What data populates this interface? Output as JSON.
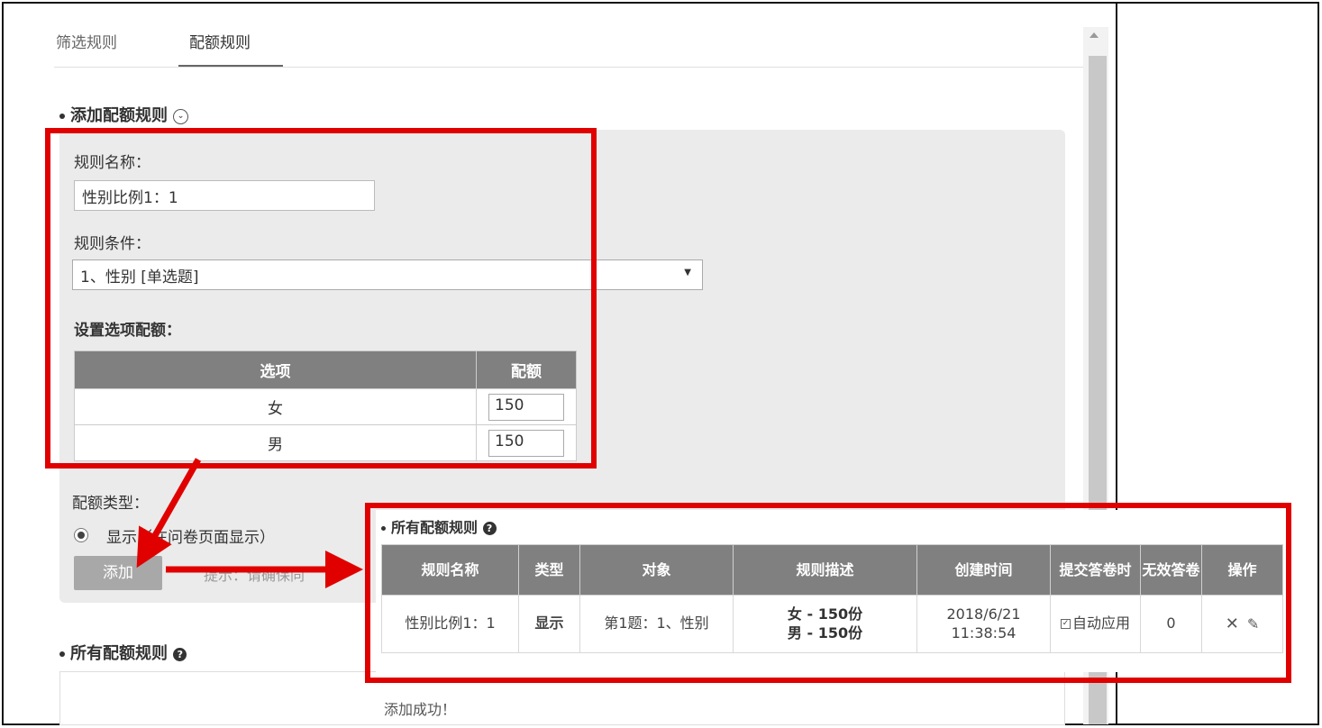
{
  "tabs": [
    {
      "label": "筛选规则",
      "active": false
    },
    {
      "label": "配额规则",
      "active": true
    }
  ],
  "add_section": {
    "title": "添加配额规则",
    "rule_name_label": "规则名称：",
    "rule_name_value": "性别比例1：1",
    "rule_condition_label": "规则条件：",
    "rule_condition_value": "1、性别 [单选题]",
    "set_quota_label": "设置选项配额：",
    "table_headers": [
      "选项",
      "配额"
    ],
    "rows": [
      {
        "option": "女",
        "quota": "150"
      },
      {
        "option": "男",
        "quota": "150"
      }
    ],
    "quota_type_label": "配额类型：",
    "radio_label": "显示（在问卷页面显示）",
    "add_button": "添加",
    "hint_text": "提示：请确保同"
  },
  "all_rules_section": {
    "title": "所有配额规则",
    "success_message": "添加成功！"
  },
  "overlay": {
    "title": "所有配额规则",
    "headers": [
      "规则名称",
      "类型",
      "对象",
      "规则描述",
      "创建时间",
      "提交答卷时",
      "无效答卷",
      "操作"
    ],
    "row": {
      "name": "性别比例1：1",
      "type": "显示",
      "target": "第1题：1、性别",
      "desc_line1": "女 - 150份",
      "desc_line2": "男 - 150份",
      "created_date": "2018/6/21",
      "created_time": "11:38:54",
      "submit_action": "自动应用",
      "invalid_count": "0"
    }
  },
  "colors": {
    "annotation_red": "#e00000",
    "header_gray": "#808080",
    "panel_gray": "#ebebeb"
  },
  "icons": [
    "help-icon",
    "expand-circle-icon",
    "caret-down-icon",
    "delete-icon",
    "edit-icon",
    "checkbox-icon",
    "scroll-up-icon"
  ]
}
